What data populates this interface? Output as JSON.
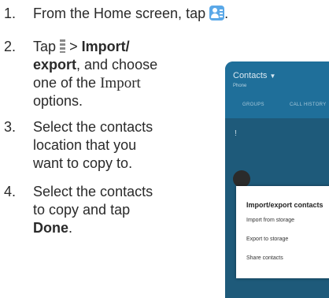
{
  "steps": [
    {
      "number": "1.",
      "lines": [
        "From the Home screen, tap"
      ]
    },
    {
      "number": "2.",
      "tap": "Tap",
      "gt": ">",
      "bold1": "Import/",
      "bold2": "export",
      "rest2": ", and choose",
      "line3": "one of the",
      "mono": "Import",
      "line4": "options."
    },
    {
      "number": "3.",
      "lines": [
        "Select the contacts",
        "location that you",
        "want to copy to."
      ]
    },
    {
      "number": "4.",
      "lines": [
        "Select the contacts",
        "to copy and tap"
      ],
      "bold": "Done",
      "after": "."
    }
  ],
  "trailing_period": ".",
  "phone": {
    "title": "Contacts",
    "caret": "▼",
    "subtitle": "Phone",
    "tabs": [
      "GROUPS",
      "CALL HISTORY"
    ],
    "list_marker": "!",
    "dialog": {
      "title": "Import/export contacts",
      "options": [
        "Import from storage",
        "Export to storage",
        "Share contacts"
      ]
    }
  },
  "colors": {
    "icon_blue": "#5aa8e8",
    "phone_header": "#1f6f9a",
    "phone_bg": "#1e5a7a"
  },
  "icons": [
    "contacts-app-icon",
    "menu-more-icon"
  ]
}
